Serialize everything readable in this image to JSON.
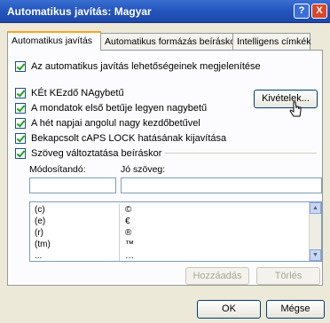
{
  "window": {
    "title": "Automatikus javítás: Magyar",
    "help_label": "?",
    "close_label": "X"
  },
  "tabs": [
    {
      "label": "Automatikus javítás",
      "active": true
    },
    {
      "label": "Automatikus formázás beíráskor",
      "active": false
    },
    {
      "label": "Intelligens címkék",
      "active": false
    }
  ],
  "options": {
    "show_buttons": {
      "label": "Az automatikus javítás lehetőségeinek megjelenítése",
      "checked": true
    },
    "two_initial_caps": {
      "label": "KÉt KEzdő NAgybetű",
      "checked": true
    },
    "capitalize_sentence": {
      "label": "A mondatok első betűje legyen nagybetű",
      "checked": true
    },
    "capitalize_days": {
      "label": "A hét napjai angolul nagy kezdőbetűvel",
      "checked": true
    },
    "caps_lock": {
      "label": "Bekapcsolt cAPS LOCK hatásának kijavítása",
      "checked": true
    },
    "replace_text": {
      "label": "Szöveg változtatása beíráskor",
      "checked": true
    }
  },
  "buttons": {
    "exceptions": "Kivételek...",
    "add": "Hozzáadás",
    "delete": "Törlés",
    "ok": "OK",
    "cancel": "Mégse"
  },
  "replace": {
    "replace_label": "Módosítandó:",
    "with_label": "Jó szöveg:",
    "replace_value": "",
    "with_value": "",
    "entries": [
      {
        "from": "(c)",
        "to": "©"
      },
      {
        "from": "(e)",
        "to": "€"
      },
      {
        "from": "(r)",
        "to": "®"
      },
      {
        "from": "(tm)",
        "to": "™"
      },
      {
        "from": "...",
        "to": "…"
      }
    ]
  },
  "scrollbar": {
    "up_arrow": "▲",
    "down_arrow": "▼"
  }
}
